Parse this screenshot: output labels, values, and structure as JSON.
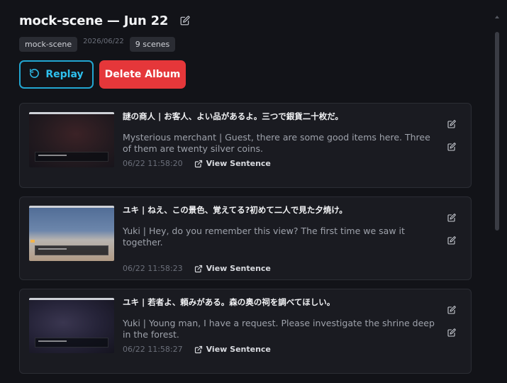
{
  "album": {
    "title": "mock-scene — Jun 22",
    "tag": "mock-scene",
    "date": "2026/06/22",
    "scene_count": "9 scenes"
  },
  "actions": {
    "replay_label": "Replay",
    "delete_label": "Delete Album"
  },
  "colors": {
    "background": "#121318",
    "card": "#1a1b21",
    "replay_accent": "#2ec0ee",
    "delete": "#e5373a"
  },
  "entries": [
    {
      "japanese": "謎の商人 | お客人、よい品があるよ。三つで銀貨二十枚だ。",
      "english": "Mysterious merchant | Guest, there are some good items here. Three of them are twenty silver coins.",
      "time": "06/22 11:58:20",
      "link_label": "View Sentence",
      "thumb": "dark-red"
    },
    {
      "japanese": "ユキ | ねえ、この景色、覚えてる?初めて二人で見た夕焼け。",
      "english": "Yuki | Hey, do you remember this view? The first time we saw it together.",
      "time": "06/22 11:58:23",
      "link_label": "View Sentence",
      "thumb": "sky"
    },
    {
      "japanese": "ユキ | 若者よ、頼みがある。森の奥の祠を調べてほしい。",
      "english": "Yuki | Young man, I have a request. Please investigate the shrine deep in the forest.",
      "time": "06/22 11:58:27",
      "link_label": "View Sentence",
      "thumb": "night"
    }
  ],
  "icons": {
    "edit": "pencil-square-icon",
    "replay": "rotate-ccw-icon",
    "link": "external-link-icon"
  }
}
